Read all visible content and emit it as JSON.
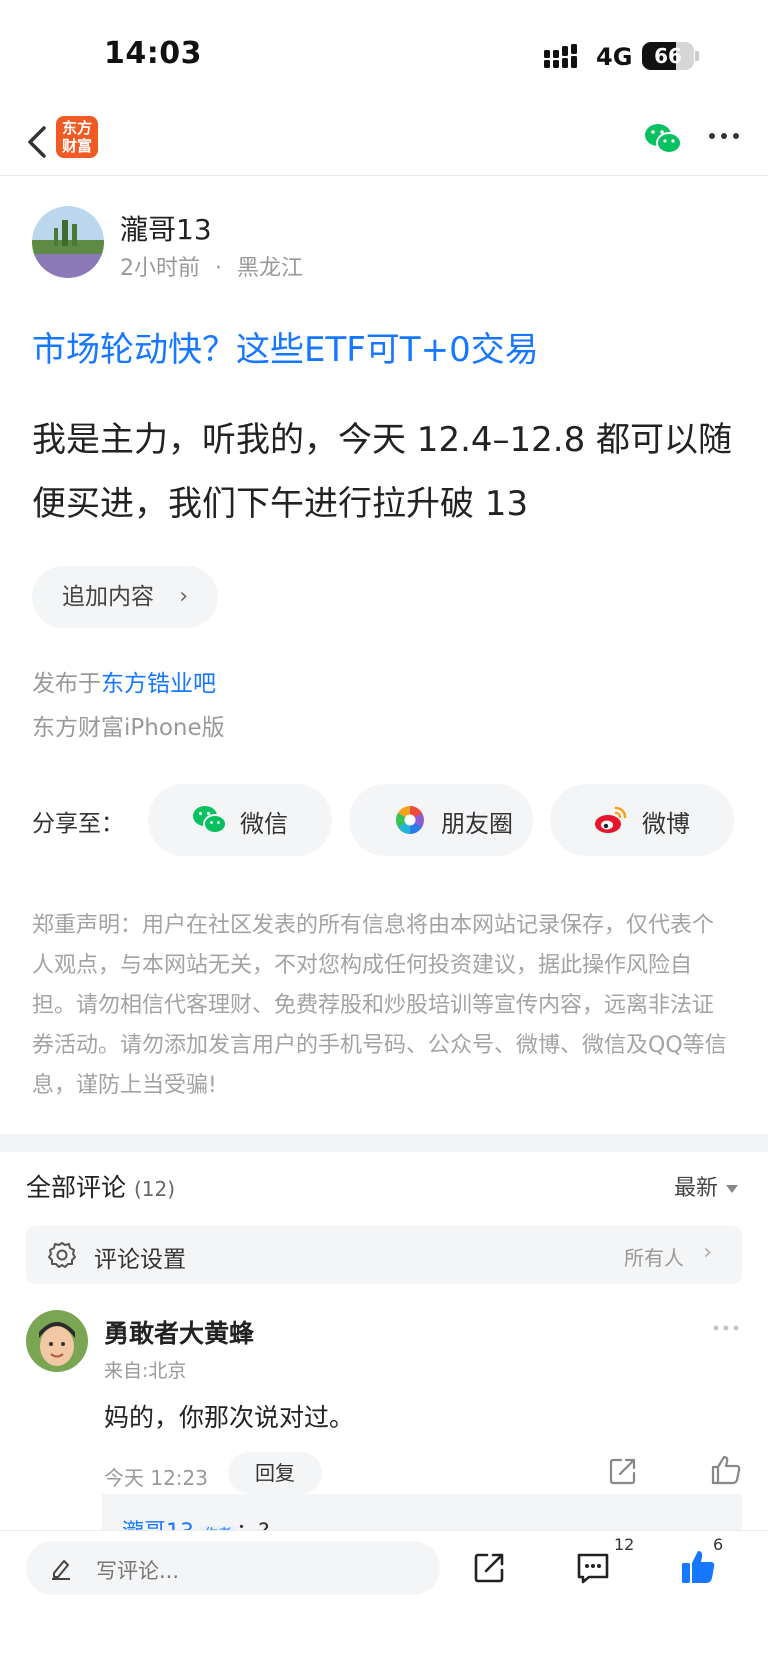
{
  "status_bar": {
    "time": "14:03",
    "network": "4G",
    "battery": "66",
    "battery_level": 0.66
  },
  "nav": {
    "logo_line1": "东方",
    "logo_line2": "财富",
    "icons": [
      "back-icon",
      "wechat-icon",
      "more-icon"
    ]
  },
  "post": {
    "author": "瀧哥13",
    "time": "2小时前",
    "separator": "·",
    "location": "黑龙江",
    "title": "市场轮动快？这些ETF可T+0交易",
    "body": "我是主力，听我的，今天 12.4–12.8 都可以随便买进，我们下午进行拉升破 13",
    "append_label": "追加内容",
    "append_chevron": "›",
    "published_prefix": "发布于",
    "forum": "东方锆业吧",
    "client": "东方财富iPhone版"
  },
  "share": {
    "label": "分享至：",
    "wechat": "微信",
    "moments": "朋友圈",
    "weibo": "微博"
  },
  "disclaimer": "郑重声明：用户在社区发表的所有信息将由本网站记录保存，仅代表个人观点，与本网站无关，不对您构成任何投资建议，据此操作风险自担。请勿相信代客理财、免费荐股和炒股培训等宣传内容，远离非法证券活动。请勿添加发言用户的手机号码、公众号、微博、微信及QQ等信息，谨防上当受骗!",
  "comments": {
    "header": "全部评论",
    "count": "(12)",
    "sort": "最新",
    "settings_label": "评论设置",
    "settings_value": "所有人",
    "settings_chevron": "›",
    "items": [
      {
        "name": "勇敢者大黄蜂",
        "from": "来自:北京",
        "text": "妈的，你那次说对过。",
        "time": "今天 12:23",
        "reply_label": "回复",
        "reply_preview_author": "瀧哥13",
        "reply_preview_tag": "作者",
        "reply_preview_text": "：?"
      }
    ]
  },
  "bottom_bar": {
    "placeholder": "写评论...",
    "comment_count": "12",
    "like_count": "6"
  },
  "colors": {
    "accent_blue": "#1677ff",
    "brand_orange": "#f15a22",
    "wechat_green": "#07c160"
  }
}
